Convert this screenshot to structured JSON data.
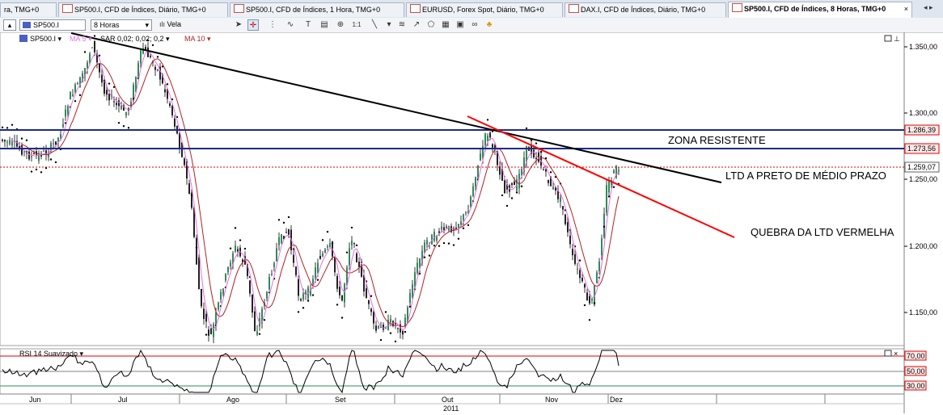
{
  "tabs": [
    {
      "label": "ra, TMG+0",
      "active": false
    },
    {
      "label": "SP500.I, CFD de Índices, Diário, TMG+0",
      "active": false
    },
    {
      "label": "SP500.I, CFD de Índices, 1 Hora, TMG+0",
      "active": false
    },
    {
      "label": "EURUSD, Forex Spot, Diário, TMG+0",
      "active": false
    },
    {
      "label": "DAX.I, CFD de Índices, Diário, TMG+0",
      "active": false
    },
    {
      "label": "SP500.I, CFD de Índices, 8 Horas, TMG+0",
      "active": true
    }
  ],
  "tab_close": "×",
  "tab_scroll": "◂ ▸",
  "toolbar": {
    "symbol": "SP500.I",
    "timeframe": "8 Horas",
    "chart_type": "Vela",
    "dropdown_arrow": "▾"
  },
  "chart": {
    "symbol_label": "SP500.I ▾",
    "ma5_label": "MA 5 ▾",
    "sar_label": "SAR 0,02; 0,02; 0,2 ▾",
    "ma10_label": "MA 10 ▾",
    "price_ticks": [
      "1.350,00",
      "1.300,00",
      "1.250,00",
      "1.200,00",
      "1.150,00"
    ],
    "price_levels": [
      {
        "label": "1.286,39",
        "value": 1286.39
      },
      {
        "label": "1.273,56",
        "value": 1273.56
      },
      {
        "label": "1.259,07",
        "value": 1259.07
      }
    ],
    "annotations": {
      "zona": "ZONA RESISTENTE",
      "ltd_preto": "LTD A PRETO DE MÉDIO PRAZO",
      "quebra": "QUEBRA DA LTD VERMELHA"
    },
    "rsi_label": "RSI 14 Suavizado ▾",
    "rsi_ticks": [
      "70,00",
      "50,00",
      "30,00"
    ],
    "months": [
      "Jun",
      "Jul",
      "Ago",
      "Set",
      "Out",
      "Nov",
      "Dez"
    ],
    "year": "2011",
    "colors": {
      "ma5": "#e36fe3",
      "ma10": "#b22222",
      "resistance": "#1c2a8c",
      "trend_black": "#000000",
      "trend_red": "#ff0000",
      "rsi_upper": "#e00000",
      "rsi_lower": "#2e8b57"
    }
  },
  "chart_data": {
    "type": "candlestick",
    "series": [
      {
        "name": "SP500.I",
        "timeframe": "8 Horas"
      }
    ],
    "ylim": [
      1125,
      1360
    ],
    "horizontal_levels": [
      1286.39,
      1273.56,
      1259.07
    ],
    "rsi": {
      "period": 14,
      "levels": [
        70,
        50,
        30
      ]
    },
    "x_labels": [
      "Jun",
      "Jul",
      "Ago",
      "Set",
      "Out",
      "Nov",
      "Dez"
    ],
    "x_year": "2011"
  }
}
